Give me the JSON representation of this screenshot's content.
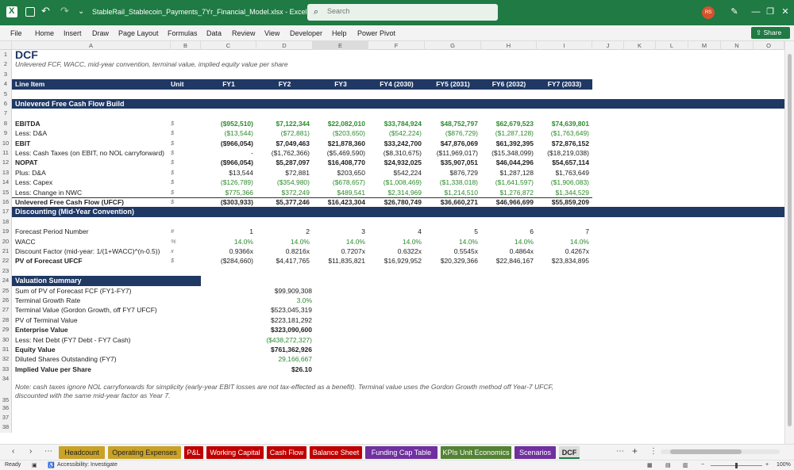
{
  "window": {
    "title": "StableRail_Stablecoin_Payments_7Yr_Financial_Model.xlsx  -  Excel",
    "search_placeholder": "Search",
    "user_initials": "RS",
    "minimize": "—",
    "restore": "❐",
    "close": "✕",
    "pen": "✎"
  },
  "menu": [
    "File",
    "Home",
    "Insert",
    "Draw",
    "Page Layout",
    "Formulas",
    "Data",
    "Review",
    "View",
    "Developer",
    "Help",
    "Power Pivot"
  ],
  "share_label": "Share",
  "columns": [
    "A",
    "B",
    "C",
    "D",
    "E",
    "F",
    "G",
    "H",
    "I",
    "J",
    "K",
    "L",
    "M",
    "N",
    "O"
  ],
  "sheet": {
    "title": "DCF",
    "subtitle": "Unlevered FCF, WACC, mid-year convention, terminal value, implied equity value per share",
    "header": {
      "label": "Line Item",
      "unit": "Unit",
      "years": [
        "FY1",
        "FY2",
        "FY3",
        "FY4 (2030)",
        "FY5 (2031)",
        "FY6 (2032)",
        "FY7 (2033)"
      ]
    },
    "section1": "Unlevered Free Cash Flow Build",
    "fcf_rows": [
      {
        "label": "EBITDA",
        "unit": "$",
        "bold": true,
        "green": true,
        "values": [
          "($952,510)",
          "$7,122,344",
          "$22,082,010",
          "$33,784,924",
          "$48,752,797",
          "$62,679,523",
          "$74,639,801"
        ]
      },
      {
        "label": "Less: D&A",
        "unit": "$",
        "bold": false,
        "green": true,
        "values": [
          "($13,544)",
          "($72,881)",
          "($203,650)",
          "($542,224)",
          "($876,729)",
          "($1,287,128)",
          "($1,763,649)"
        ]
      },
      {
        "label": "EBIT",
        "unit": "$",
        "bold": true,
        "green": false,
        "values": [
          "($966,054)",
          "$7,049,463",
          "$21,878,360",
          "$33,242,700",
          "$47,876,069",
          "$61,392,395",
          "$72,876,152"
        ]
      },
      {
        "label": "Less: Cash Taxes (on EBIT, no NOL carryforward)",
        "unit": "$",
        "bold": false,
        "green": false,
        "values": [
          "-",
          "($1,762,366)",
          "($5,469,590)",
          "($8,310,675)",
          "($11,969,017)",
          "($15,348,099)",
          "($18,219,038)"
        ]
      },
      {
        "label": "NOPAT",
        "unit": "$",
        "bold": true,
        "green": false,
        "values": [
          "($966,054)",
          "$5,287,097",
          "$16,408,770",
          "$24,932,025",
          "$35,907,051",
          "$46,044,296",
          "$54,657,114"
        ]
      },
      {
        "label": "Plus: D&A",
        "unit": "$",
        "bold": false,
        "green": false,
        "values": [
          "$13,544",
          "$72,881",
          "$203,650",
          "$542,224",
          "$876,729",
          "$1,287,128",
          "$1,763,649"
        ]
      },
      {
        "label": "Less: Capex",
        "unit": "$",
        "bold": false,
        "green": true,
        "values": [
          "($126,789)",
          "($354,980)",
          "($678,657)",
          "($1,008,469)",
          "($1,338,018)",
          "($1,641,597)",
          "($1,906,083)"
        ]
      },
      {
        "label": "Less: Change in NWC",
        "unit": "$",
        "bold": false,
        "green": true,
        "values": [
          "$775,366",
          "$372,249",
          "$489,541",
          "$2,314,969",
          "$1,214,510",
          "$1,276,872",
          "$1,344,529"
        ]
      },
      {
        "label": "Unlevered Free Cash Flow (UFCF)",
        "unit": "$",
        "bold": true,
        "green": false,
        "values": [
          "($303,933)",
          "$5,377,246",
          "$16,423,304",
          "$26,780,749",
          "$36,660,271",
          "$46,966,699",
          "$55,859,209"
        ]
      }
    ],
    "section2": "Discounting (Mid-Year Convention)",
    "disc_rows": [
      {
        "label": "Forecast Period Number",
        "unit": "#",
        "bold": false,
        "green": false,
        "values": [
          "1",
          "2",
          "3",
          "4",
          "5",
          "6",
          "7"
        ]
      },
      {
        "label": "WACC",
        "unit": "%",
        "bold": false,
        "green": true,
        "values": [
          "14.0%",
          "14.0%",
          "14.0%",
          "14.0%",
          "14.0%",
          "14.0%",
          "14.0%"
        ]
      },
      {
        "label": "Discount Factor (mid-year: 1/(1+WACC)^(n-0.5))",
        "unit": "x",
        "bold": false,
        "green": false,
        "values": [
          "0.9366x",
          "0.8216x",
          "0.7207x",
          "0.6322x",
          "0.5545x",
          "0.4864x",
          "0.4267x"
        ]
      },
      {
        "label": "PV of Forecast UFCF",
        "unit": "$",
        "bold": true,
        "green": false,
        "values": [
          "($284,660)",
          "$4,417,765",
          "$11,835,821",
          "$16,929,952",
          "$20,329,366",
          "$22,846,167",
          "$23,834,895"
        ]
      }
    ],
    "section3": "Valuation Summary",
    "val_rows": [
      {
        "label": "Sum of PV of Forecast FCF (FY1-FY7)",
        "bold": false,
        "green": false,
        "value": "$99,909,308"
      },
      {
        "label": "Terminal Growth Rate",
        "bold": false,
        "green": true,
        "value": "3.0%"
      },
      {
        "label": "Terminal Value (Gordon Growth, off FY7 UFCF)",
        "bold": false,
        "green": false,
        "value": "$523,045,319"
      },
      {
        "label": "PV of Terminal Value",
        "bold": false,
        "green": false,
        "value": "$223,181,292"
      },
      {
        "label": "Enterprise Value",
        "bold": true,
        "green": false,
        "value": "$323,090,600"
      },
      {
        "label": "Less: Net Debt (FY7 Debt - FY7 Cash)",
        "bold": false,
        "green": true,
        "value": "($438,272,327)"
      },
      {
        "label": "Equity Value",
        "bold": true,
        "green": false,
        "value": "$761,362,926"
      },
      {
        "label": "Diluted Shares Outstanding (FY7)",
        "bold": false,
        "green": true,
        "value": "29,166,667"
      },
      {
        "label": "Implied Value per Share",
        "bold": true,
        "green": false,
        "value": "$26.10"
      }
    ],
    "note": "Note: cash taxes ignore NOL carryforwards for simplicity (early-year EBIT losses are not tax-effected as a benefit). Terminal value uses the Gordon Growth method off Year-7 UFCF, discounted with the same mid-year factor as Year 7."
  },
  "sheet_tabs": [
    {
      "label": "Headcount",
      "color": "#c9a227"
    },
    {
      "label": "Operating Expenses",
      "color": "#c9a227"
    },
    {
      "label": "P&L",
      "color": "#c00000"
    },
    {
      "label": "Working Capital",
      "color": "#c00000"
    },
    {
      "label": "Cash Flow",
      "color": "#c00000"
    },
    {
      "label": "Balance Sheet",
      "color": "#c00000"
    },
    {
      "label": "Funding Cap Table",
      "color": "#7030a0"
    },
    {
      "label": "KPIs Unit Economics",
      "color": "#548235"
    },
    {
      "label": "Scenarios",
      "color": "#7030a0"
    },
    {
      "label": "DCF",
      "color": "#dcdcdc"
    }
  ],
  "status": {
    "ready": "Ready",
    "accessibility": "Accessibility: Investigate",
    "zoom": "100%"
  }
}
